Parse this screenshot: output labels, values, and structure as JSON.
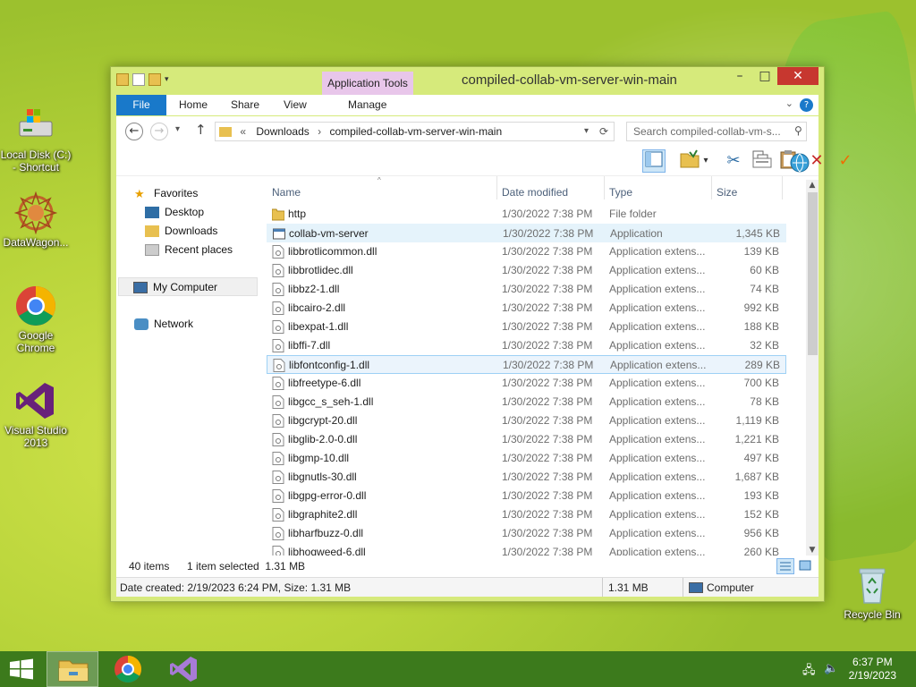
{
  "desktop": {
    "icons": [
      {
        "label": "Local Disk (C:) - Shortcut"
      },
      {
        "label": "DataWagon..."
      },
      {
        "label": "Google Chrome"
      },
      {
        "label": "Visual Studio 2013"
      },
      {
        "label": "Recycle Bin"
      }
    ]
  },
  "window": {
    "title": "compiled-collab-vm-server-win-main",
    "app_tools_label": "Application Tools",
    "tabs": {
      "file": "File",
      "home": "Home",
      "share": "Share",
      "view": "View",
      "manage": "Manage"
    },
    "address": {
      "prefix": "«",
      "crumb1": "Downloads",
      "crumb2": "compiled-collab-vm-server-win-main"
    },
    "search_placeholder": "Search compiled-collab-vm-s...",
    "nav": {
      "favorites": "Favorites",
      "desktop": "Desktop",
      "downloads": "Downloads",
      "recent": "Recent places",
      "computer": "My Computer",
      "network": "Network"
    },
    "columns": {
      "name": "Name",
      "date": "Date modified",
      "type": "Type",
      "size": "Size"
    },
    "files": [
      {
        "name": "http",
        "date": "1/30/2022 7:38 PM",
        "type": "File folder",
        "size": "",
        "kind": "folder"
      },
      {
        "name": "collab-vm-server",
        "date": "1/30/2022 7:38 PM",
        "type": "Application",
        "size": "1,345 KB",
        "kind": "app"
      },
      {
        "name": "libbrotlicommon.dll",
        "date": "1/30/2022 7:38 PM",
        "type": "Application extens...",
        "size": "139 KB",
        "kind": "dll"
      },
      {
        "name": "libbrotlidec.dll",
        "date": "1/30/2022 7:38 PM",
        "type": "Application extens...",
        "size": "60 KB",
        "kind": "dll"
      },
      {
        "name": "libbz2-1.dll",
        "date": "1/30/2022 7:38 PM",
        "type": "Application extens...",
        "size": "74 KB",
        "kind": "dll"
      },
      {
        "name": "libcairo-2.dll",
        "date": "1/30/2022 7:38 PM",
        "type": "Application extens...",
        "size": "992 KB",
        "kind": "dll"
      },
      {
        "name": "libexpat-1.dll",
        "date": "1/30/2022 7:38 PM",
        "type": "Application extens...",
        "size": "188 KB",
        "kind": "dll"
      },
      {
        "name": "libffi-7.dll",
        "date": "1/30/2022 7:38 PM",
        "type": "Application extens...",
        "size": "32 KB",
        "kind": "dll"
      },
      {
        "name": "libfontconfig-1.dll",
        "date": "1/30/2022 7:38 PM",
        "type": "Application extens...",
        "size": "289 KB",
        "kind": "dll"
      },
      {
        "name": "libfreetype-6.dll",
        "date": "1/30/2022 7:38 PM",
        "type": "Application extens...",
        "size": "700 KB",
        "kind": "dll"
      },
      {
        "name": "libgcc_s_seh-1.dll",
        "date": "1/30/2022 7:38 PM",
        "type": "Application extens...",
        "size": "78 KB",
        "kind": "dll"
      },
      {
        "name": "libgcrypt-20.dll",
        "date": "1/30/2022 7:38 PM",
        "type": "Application extens...",
        "size": "1,119 KB",
        "kind": "dll"
      },
      {
        "name": "libglib-2.0-0.dll",
        "date": "1/30/2022 7:38 PM",
        "type": "Application extens...",
        "size": "1,221 KB",
        "kind": "dll"
      },
      {
        "name": "libgmp-10.dll",
        "date": "1/30/2022 7:38 PM",
        "type": "Application extens...",
        "size": "497 KB",
        "kind": "dll"
      },
      {
        "name": "libgnutls-30.dll",
        "date": "1/30/2022 7:38 PM",
        "type": "Application extens...",
        "size": "1,687 KB",
        "kind": "dll"
      },
      {
        "name": "libgpg-error-0.dll",
        "date": "1/30/2022 7:38 PM",
        "type": "Application extens...",
        "size": "193 KB",
        "kind": "dll"
      },
      {
        "name": "libgraphite2.dll",
        "date": "1/30/2022 7:38 PM",
        "type": "Application extens...",
        "size": "152 KB",
        "kind": "dll"
      },
      {
        "name": "libharfbuzz-0.dll",
        "date": "1/30/2022 7:38 PM",
        "type": "Application extens...",
        "size": "956 KB",
        "kind": "dll"
      },
      {
        "name": "libhogweed-6.dll",
        "date": "1/30/2022 7:38 PM",
        "type": "Application extens...",
        "size": "260 KB",
        "kind": "dll"
      }
    ],
    "status": {
      "count": "40 items",
      "selected": "1 item selected  1.31 MB"
    },
    "details": {
      "info": "Date created: 2/19/2023 6:24 PM, Size: 1.31 MB",
      "size": "1.31 MB",
      "location": "Computer"
    }
  },
  "taskbar": {
    "time": "6:37 PM",
    "date": "2/19/2023"
  },
  "colors": {
    "file_tab": "#1979ca",
    "app_tools": "#e8c6ea",
    "selected_border": "#9ed1f5",
    "close_button": "#c7372f",
    "taskbar": "#3c7a1c"
  }
}
